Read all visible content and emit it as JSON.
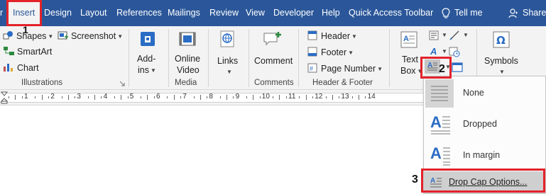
{
  "tabs": [
    {
      "label": "Insert",
      "active": true
    },
    {
      "label": "Design"
    },
    {
      "label": "Layout"
    },
    {
      "label": "References"
    },
    {
      "label": "Mailings"
    },
    {
      "label": "Review"
    },
    {
      "label": "View"
    },
    {
      "label": "Developer"
    },
    {
      "label": "Help"
    },
    {
      "label": "Quick Access Toolbar"
    }
  ],
  "tab_cutoff": "r",
  "tell_me": "Tell me",
  "share": "Share",
  "ribbon": {
    "illustrations": {
      "shapes": "Shapes",
      "screenshot": "Screenshot",
      "smartart": "SmartArt",
      "chart": "Chart",
      "label": "Illustrations"
    },
    "addins": {
      "line1": "Add-",
      "line2": "ins"
    },
    "media": {
      "line1": "Online",
      "line2": "Video",
      "label": "Media"
    },
    "links": {
      "label": "Links"
    },
    "comments": {
      "button": "Comment",
      "label": "Comments"
    },
    "header_footer": {
      "header": "Header",
      "footer": "Footer",
      "page_number": "Page Number",
      "label": "Header & Footer"
    },
    "text": {
      "line1": "Text",
      "line2": "Box"
    },
    "symbols": {
      "label": "Symbols"
    }
  },
  "ruler_numbers": [
    "1",
    "2",
    "3",
    "4",
    "5",
    "6",
    "7",
    "8",
    "9",
    "10",
    "11",
    "12",
    "13",
    "14"
  ],
  "drop_cap_menu": {
    "items": [
      {
        "label": "None"
      },
      {
        "label": "Dropped"
      },
      {
        "label": "In margin"
      }
    ],
    "options": "Drop Cap Options..."
  },
  "callouts": [
    "1",
    "2",
    "3"
  ],
  "colors": {
    "ribbon_blue": "#2b579a",
    "highlight_red": "#e3222a",
    "icon_blue": "#2b6cc4"
  }
}
